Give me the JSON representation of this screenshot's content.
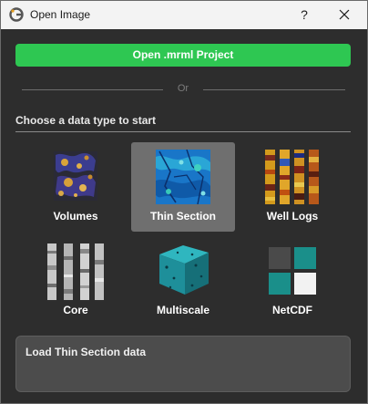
{
  "window": {
    "title": "Open Image",
    "help_label": "?"
  },
  "actions": {
    "open_project_label": "Open .mrml Project"
  },
  "divider": {
    "or_label": "Or"
  },
  "data_types": {
    "heading": "Choose a data type to start",
    "items": [
      {
        "label": "Volumes",
        "icon": "volumes-icon",
        "selected": false
      },
      {
        "label": "Thin Section",
        "icon": "thin-section-icon",
        "selected": true
      },
      {
        "label": "Well Logs",
        "icon": "well-logs-icon",
        "selected": false
      },
      {
        "label": "Core",
        "icon": "core-icon",
        "selected": false
      },
      {
        "label": "Multiscale",
        "icon": "multiscale-icon",
        "selected": false
      },
      {
        "label": "NetCDF",
        "icon": "netcdf-icon",
        "selected": false
      }
    ]
  },
  "status": {
    "message": "Load Thin Section data"
  },
  "colors": {
    "accent_green": "#2ec752",
    "selected_tile": "#6f6f6f",
    "background": "#2d2d2d"
  }
}
